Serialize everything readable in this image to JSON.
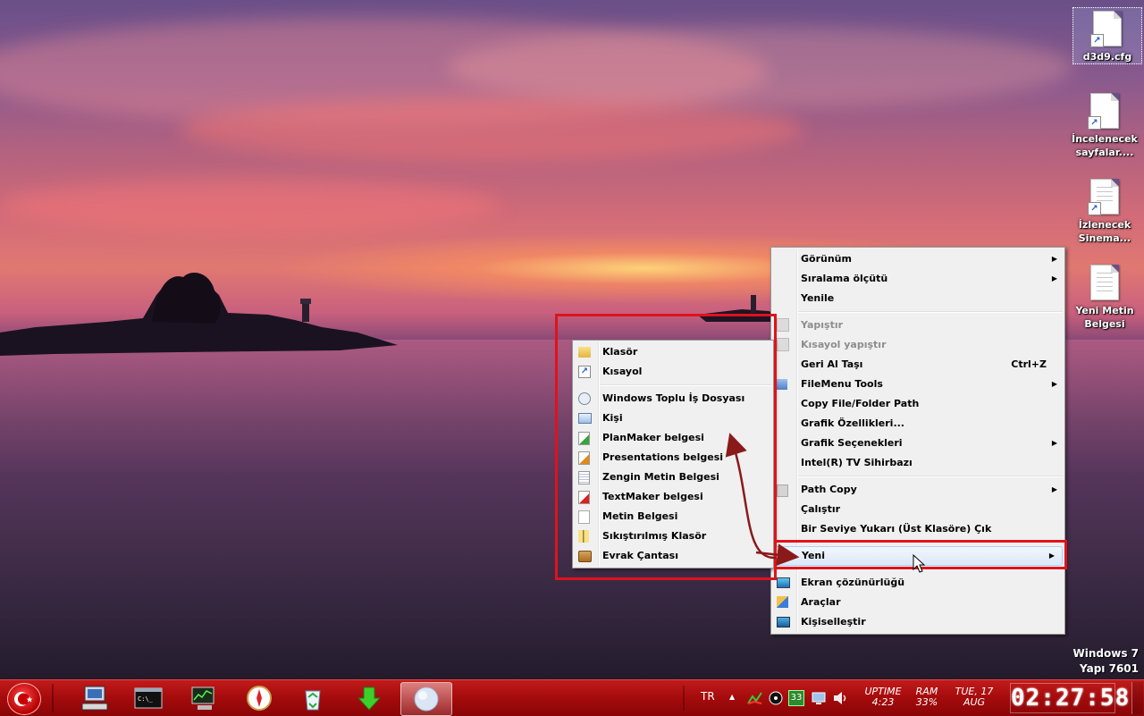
{
  "desktop": {
    "icons": [
      {
        "label": "d3d9.cfg"
      },
      {
        "label": "İncelenecek sayfalar...."
      },
      {
        "label": "İzlenecek Sinema..."
      },
      {
        "label": "Yeni Metin Belgesi"
      }
    ],
    "watermark": {
      "line1": "Windows 7",
      "line2": "Yapı 7601"
    }
  },
  "context_menu": {
    "items": [
      {
        "label": "Görünüm",
        "submenu": true
      },
      {
        "label": "Sıralama ölçütü",
        "submenu": true
      },
      {
        "label": "Yenile"
      },
      {
        "label": "Yapıştır",
        "disabled": true
      },
      {
        "label": "Kısayol yapıştır",
        "disabled": true
      },
      {
        "label": "Geri Al Taşı",
        "shortcut": "Ctrl+Z"
      },
      {
        "label": "FileMenu Tools",
        "submenu": true
      },
      {
        "label": "Copy File/Folder Path"
      },
      {
        "label": "Grafik Özellikleri..."
      },
      {
        "label": "Grafik Seçenekleri",
        "submenu": true
      },
      {
        "label": "Intel(R) TV Sihirbazı"
      },
      {
        "label": "Path Copy",
        "submenu": true
      },
      {
        "label": "Çalıştır"
      },
      {
        "label": "Bir Seviye Yukarı (Üst Klasöre) Çık"
      },
      {
        "label": "Yeni",
        "submenu": true,
        "highlighted": true
      },
      {
        "label": "Ekran çözünürlüğü"
      },
      {
        "label": "Araçlar"
      },
      {
        "label": "Kişiselleştir"
      }
    ],
    "submenu_arrow": "▶"
  },
  "new_submenu": {
    "items": [
      {
        "label": "Klasör",
        "icon": "folder-icon"
      },
      {
        "label": "Kısayol",
        "icon": "shortcut-icon"
      },
      {
        "label": "Windows Toplu İş Dosyası",
        "icon": "batch-file-icon"
      },
      {
        "label": "Kişi",
        "icon": "contact-icon"
      },
      {
        "label": "PlanMaker belgesi",
        "icon": "planmaker-icon"
      },
      {
        "label": "Presentations belgesi",
        "icon": "presentations-icon"
      },
      {
        "label": "Zengin Metin Belgesi",
        "icon": "rich-text-icon"
      },
      {
        "label": "TextMaker belgesi",
        "icon": "textmaker-icon"
      },
      {
        "label": "Metin Belgesi",
        "icon": "text-document-icon"
      },
      {
        "label": "Sıkıştırılmış Klasör",
        "icon": "zip-folder-icon"
      },
      {
        "label": "Evrak Çantası",
        "icon": "briefcase-icon"
      }
    ]
  },
  "taskbar": {
    "language": "TR",
    "badge": "33",
    "uptime_label": "UPTIME",
    "uptime_value": "4:23",
    "ram_label": "RAM",
    "ram_value": "33%",
    "date_line1": "TUE, 17",
    "date_line2": "AUG",
    "clock": "02:27:58"
  },
  "colors": {
    "highlight_box": "#e0121b",
    "taskbar": "#a40b0c"
  }
}
